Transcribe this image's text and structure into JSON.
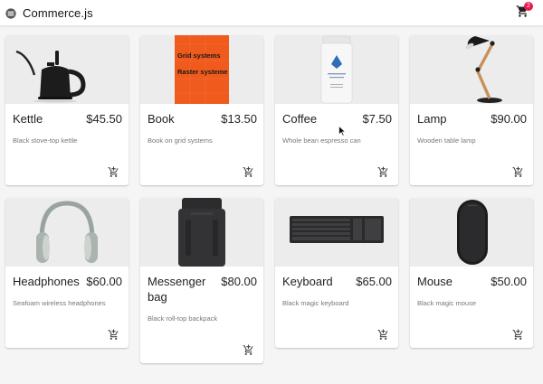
{
  "app": {
    "title": "Commerce.js",
    "cart_count": "2",
    "cart_icon": "shopping-cart-icon",
    "logo_icon": "commerce-logo-icon",
    "accent": "#e8194f"
  },
  "products": [
    {
      "name": "Kettle",
      "price": "$45.50",
      "description": "Black stove-top kettle",
      "image": "kettle-image"
    },
    {
      "name": "Book",
      "price": "$13.50",
      "description": "Book on grid systems",
      "image": "book-image",
      "cover_text_1": "Grid systems",
      "cover_text_2": "Raster systeme"
    },
    {
      "name": "Coffee",
      "price": "$7.50",
      "description": "Whole bean espresso can",
      "image": "coffee-can-image"
    },
    {
      "name": "Lamp",
      "price": "$90.00",
      "description": "Wooden table lamp",
      "image": "lamp-image"
    },
    {
      "name": "Headphones",
      "price": "$60.00",
      "description": "Seafoam wireless headphones",
      "image": "headphones-image"
    },
    {
      "name": "Messenger bag",
      "price": "$80.00",
      "description": "Black roll-top backpack",
      "image": "backpack-image"
    },
    {
      "name": "Keyboard",
      "price": "$65.00",
      "description": "Black magic keyboard",
      "image": "keyboard-image"
    },
    {
      "name": "Mouse",
      "price": "$50.00",
      "description": "Black magic mouse",
      "image": "mouse-image"
    }
  ],
  "card_action_icon": "add-shopping-cart-icon"
}
